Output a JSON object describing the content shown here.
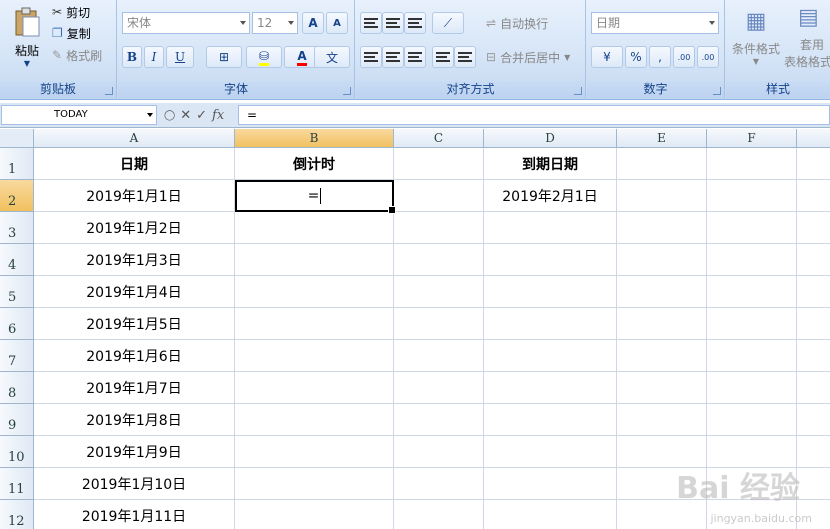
{
  "ribbon": {
    "clipboard": {
      "paste": "粘贴",
      "cut": "剪切",
      "copy": "复制",
      "format_painter": "格式刷",
      "label": "剪贴板"
    },
    "font": {
      "font_name": "宋体",
      "font_size": "12",
      "bold": "B",
      "italic": "I",
      "underline": "U",
      "grow": "A",
      "shrink": "A",
      "label": "字体",
      "phonetic": "文"
    },
    "alignment": {
      "wrap_text": "自动换行",
      "merge_center": "合并后居中",
      "label": "对齐方式"
    },
    "number": {
      "format": "日期",
      "percent": "%",
      "comma": ",",
      "inc_decimal": ".00",
      "dec_decimal": ".00",
      "label": "数字"
    },
    "styles": {
      "conditional": "条件格式",
      "table_format_1": "套用",
      "table_format_2": "表格格式",
      "label": "样式"
    }
  },
  "formula_bar": {
    "name_box": "TODAY",
    "cancel": "✕",
    "enter": "✓",
    "fx": "fx",
    "formula": "="
  },
  "columns": [
    "A",
    "B",
    "C",
    "D",
    "E",
    "F"
  ],
  "rows": [
    "1",
    "2",
    "3",
    "4",
    "5",
    "6",
    "7",
    "8",
    "9",
    "10",
    "11",
    "12"
  ],
  "cells": {
    "A1": "日期",
    "B1": "倒计时",
    "D1": "到期日期",
    "A2": "2019年1月1日",
    "B2": "=",
    "D2": "2019年2月1日",
    "A3": "2019年1月2日",
    "A4": "2019年1月3日",
    "A5": "2019年1月4日",
    "A6": "2019年1月5日",
    "A7": "2019年1月6日",
    "A8": "2019年1月7日",
    "A9": "2019年1月8日",
    "A10": "2019年1月9日",
    "A11": "2019年1月10日",
    "A12": "2019年1月11日"
  },
  "watermark": {
    "brand": "Bai 经验",
    "url": "jingyan.baidu.com"
  },
  "colors": {
    "selected_header": "#f1c15f",
    "ribbon_bg": "#d6e5f7",
    "gridline": "#d0d7e5"
  }
}
